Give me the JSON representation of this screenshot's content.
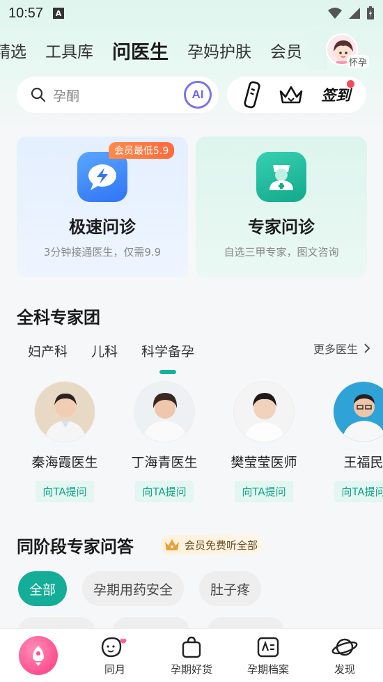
{
  "status_bar": {
    "time": "10:57",
    "a_icon": "A"
  },
  "top_tabs": [
    "精选",
    "工具库",
    "问医生",
    "孕妈护肤",
    "会员"
  ],
  "active_tab_index": 2,
  "avatar": {
    "label": "怀孕"
  },
  "search": {
    "placeholder": "孕酮",
    "ai_label": "AI"
  },
  "toolbar": {
    "checkin_label": "签到"
  },
  "consult_cards": {
    "fast": {
      "title": "极速问诊",
      "subtitle": "3分钟接通医生，仅需9.9",
      "badge": "会员最低5.9"
    },
    "expert": {
      "title": "专家问诊",
      "subtitle": "自选三甲专家，图文咨询"
    }
  },
  "expert_team": {
    "title": "全科专家团",
    "tabs": [
      "妇产科",
      "儿科",
      "科学备孕"
    ],
    "active_tab_index": 2,
    "more_label": "更多医生",
    "ask_label": "向TA提问",
    "doctors": [
      {
        "name": "秦海霞医生"
      },
      {
        "name": "丁海青医生"
      },
      {
        "name": "樊莹莹医师"
      },
      {
        "name": "王福民"
      }
    ]
  },
  "qa_section": {
    "title": "同阶段专家问答",
    "member_badge": "会员免费听全部",
    "chips": [
      "全部",
      "孕期用药安全",
      "肚子疼"
    ],
    "active_chip_index": 0
  },
  "bottom_nav": {
    "items": [
      {
        "label": "",
        "icon": "home-rocket-icon"
      },
      {
        "label": "同月",
        "icon": "face-heart-icon"
      },
      {
        "label": "孕期好货",
        "icon": "shopping-bag-icon"
      },
      {
        "label": "孕期档案",
        "icon": "profile-card-icon"
      },
      {
        "label": "发现",
        "icon": "planet-icon"
      }
    ]
  },
  "colors": {
    "accent": "#14ad97",
    "vip_orange": "#ff7a42",
    "home_pink": "#ff4f8f",
    "ai_purple": "#6c63ff"
  }
}
